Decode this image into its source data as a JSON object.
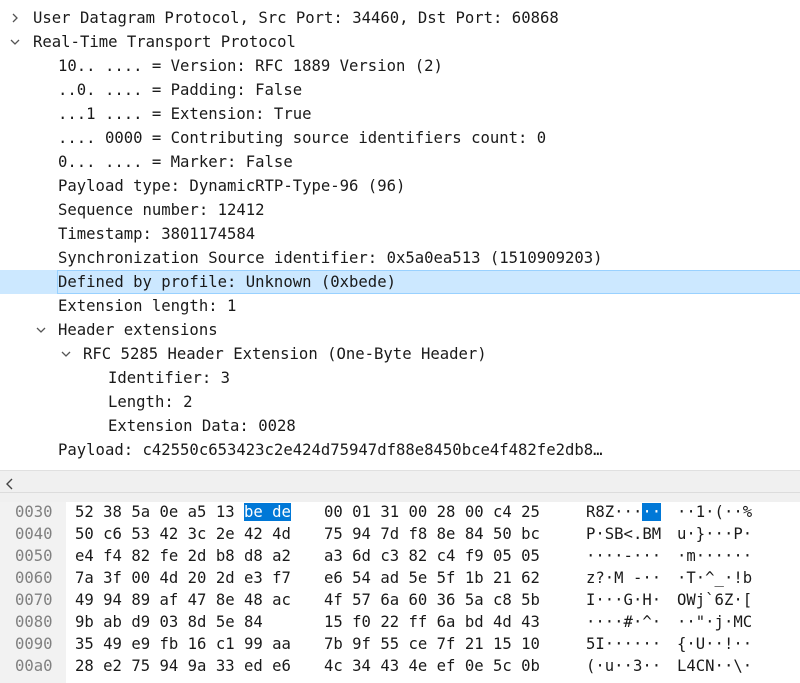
{
  "tree": {
    "rows": [
      {
        "text": "User Datagram Protocol, Src Port: 34460, Dst Port: 60868",
        "arrow": "collapsed"
      },
      {
        "text": "Real-Time Transport Protocol",
        "arrow": "expanded"
      },
      {
        "text": "10.. .... = Version: RFC 1889 Version (2)"
      },
      {
        "text": "..0. .... = Padding: False"
      },
      {
        "text": "...1 .... = Extension: True"
      },
      {
        "text": ".... 0000 = Contributing source identifiers count: 0"
      },
      {
        "text": "0... .... = Marker: False"
      },
      {
        "text": "Payload type: DynamicRTP-Type-96 (96)"
      },
      {
        "text": "Sequence number: 12412"
      },
      {
        "text": "Timestamp: 3801174584"
      },
      {
        "text": "Synchronization Source identifier: 0x5a0ea513 (1510909203)"
      },
      {
        "text": "Defined by profile: Unknown (0xbede)",
        "selected": true
      },
      {
        "text": "Extension length: 1"
      },
      {
        "text": "Header extensions",
        "arrow": "expanded"
      },
      {
        "text": "RFC 5285 Header Extension (One-Byte Header)",
        "arrow": "expanded"
      },
      {
        "text": "Identifier: 3"
      },
      {
        "text": "Length: 2"
      },
      {
        "text": "Extension Data: 0028"
      },
      {
        "text": "Payload: c42550c653423c2e424d75947df88e8450bce4f482fe2db8…"
      }
    ]
  },
  "hex": {
    "rows": [
      {
        "offset": "0030",
        "h1": "52 38 5a 0e a5 13 ",
        "h1_hl": "be de",
        "h2": "00 01 31 00 28 00 c4 25",
        "a1": "R8Z···",
        "a1_hl": "··",
        "a2": "··1·(··%"
      },
      {
        "offset": "0040",
        "h1": "50 c6 53 42 3c 2e 42 4d",
        "h2": "75 94 7d f8 8e 84 50 bc",
        "a1": "P·SB<.BM",
        "a2": "u·}···P·"
      },
      {
        "offset": "0050",
        "h1": "e4 f4 82 fe 2d b8 d8 a2",
        "h2": "a3 6d c3 82 c4 f9 05 05",
        "a1": "····-···",
        "a2": "·m······"
      },
      {
        "offset": "0060",
        "h1": "7a 3f 00 4d 20 2d e3 f7",
        "h2": "e6 54 ad 5e 5f 1b 21 62",
        "a1": "z?·M -··",
        "a2": "·T·^_·!b"
      },
      {
        "offset": "0070",
        "h1": "49 94 89 af 47 8e 48 ac",
        "h2": "4f 57 6a 60 36 5a c8 5b",
        "a1": "I···G·H·",
        "a2": "OWj`6Z·["
      },
      {
        "offset": "0080",
        "h1": "9b ab d9 03 8d 5e 84",
        "h2": "15 f0 22 ff 6a bd 4d 43",
        "a1": "····#·^·",
        "a2": "··\"·j·MC"
      },
      {
        "offset": "0090",
        "h1": "35 49 e9 fb 16 c1 99 aa",
        "h2": "7b 9f 55 ce 7f 21 15 10",
        "a1": "5I······",
        "a2": "{·U··!··"
      },
      {
        "offset": "00a0",
        "h1": "28 e2 75 94 9a 33 ed e6",
        "h2": "4c 34 43 4e ef 0e 5c 0b",
        "a1": "(·u··3··",
        "a2": "L4CN··\\·"
      }
    ]
  },
  "colors": {
    "selection_bg": "#cce8ff",
    "selection_border": "#99d1ff",
    "hex_highlight": "#0078d7"
  }
}
